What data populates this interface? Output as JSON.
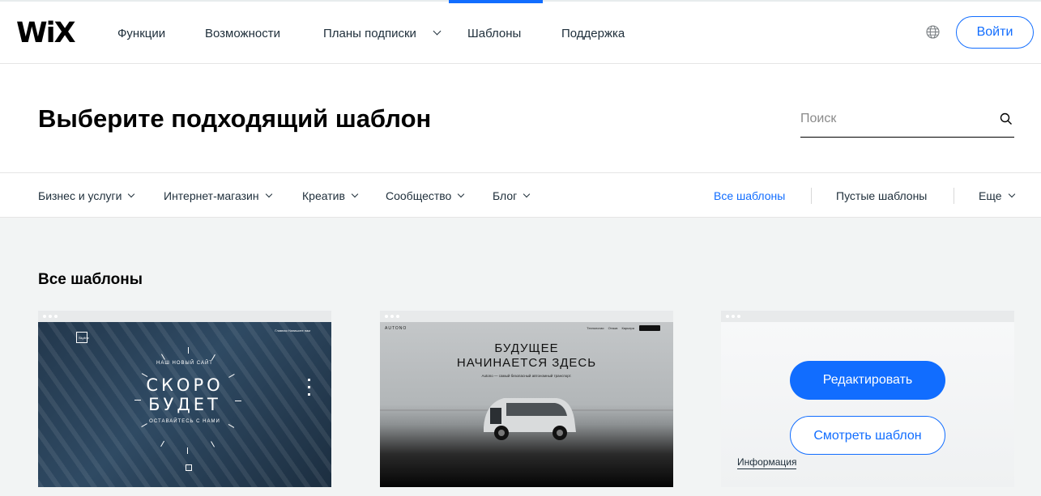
{
  "nav": {
    "logo": "WiX",
    "items": [
      "Функции",
      "Возможности",
      "Планы подписки",
      "Шаблоны",
      "Поддержка"
    ],
    "active_item": "Шаблоны",
    "globe_icon": "globe-icon",
    "login_label": "Войти"
  },
  "header": {
    "title": "Выберите подходящий шаблон",
    "search_placeholder": "Поиск",
    "search_icon": "search-icon"
  },
  "categories": {
    "left": [
      "Бизнес и услуги",
      "Интернет-магазин",
      "Креатив",
      "Сообщество",
      "Блог"
    ],
    "right": [
      "Все шаблоны",
      "Пустые шаблоны",
      "Еще"
    ],
    "active": "Все шаблоны"
  },
  "gallery": {
    "title": "Все шаблоны",
    "cards": [
      {
        "kind": "coming-soon",
        "small_top": "НАШ НОВЫЙ САЙТ",
        "big_line1": "СКОРО",
        "big_line2": "БУДЕТ",
        "small_bottom": "ОСТАВАЙТЕСЬ С НАМИ",
        "brand": "Skyline",
        "menu": "Главная   Напишите нам"
      },
      {
        "kind": "autono",
        "brand": "AUTONO",
        "links": "Технологии Отзыв Карьера",
        "line1": "БУДУЩЕЕ",
        "line2": "НАЧИНАЕТСЯ ЗДЕСЬ",
        "sub": "Autono — самый безопасный автономный транспорт."
      },
      {
        "kind": "hover",
        "edit_label": "Редактировать",
        "view_label": "Смотреть шаблон",
        "info_label": "Информация"
      }
    ]
  },
  "colors": {
    "accent": "#116dff",
    "text": "#20303c",
    "gallery_bg": "#f2f4f4"
  }
}
